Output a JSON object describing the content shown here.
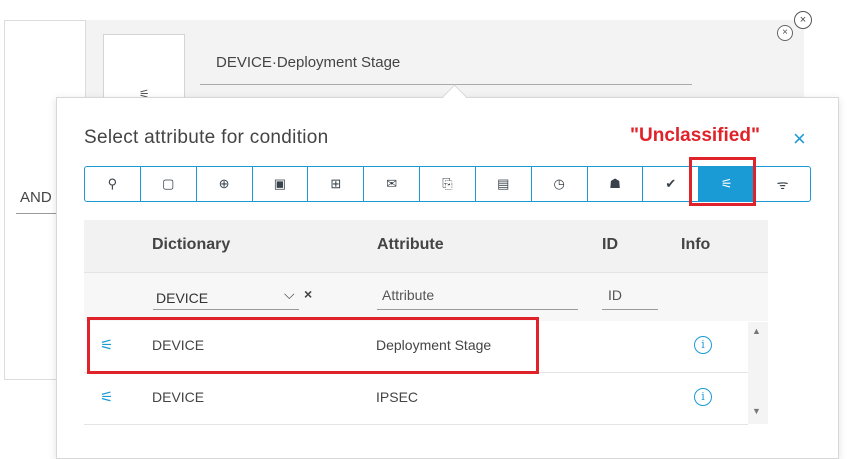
{
  "background": {
    "logic_operator": "AND",
    "condition_value": "DEVICE·Deployment Stage"
  },
  "popup": {
    "title": "Select attribute for condition",
    "annotation": "\"Unclassified\"",
    "close_glyph": "×"
  },
  "categories": [
    {
      "name": "location",
      "glyph": "⚲"
    },
    {
      "name": "endpoint",
      "glyph": "▢"
    },
    {
      "name": "network",
      "glyph": "⊕"
    },
    {
      "name": "device",
      "glyph": "▣"
    },
    {
      "name": "network-device",
      "glyph": "⊞"
    },
    {
      "name": "email",
      "glyph": "✉"
    },
    {
      "name": "certificate",
      "glyph": "⎘"
    },
    {
      "name": "server",
      "glyph": "▤"
    },
    {
      "name": "time",
      "glyph": "◷"
    },
    {
      "name": "identity",
      "glyph": "☗"
    },
    {
      "name": "posture",
      "glyph": "✔"
    },
    {
      "name": "unclassified",
      "glyph": "⚟",
      "active": true
    },
    {
      "name": "wireless",
      "glyph": "ᯤ"
    }
  ],
  "table": {
    "headers": {
      "dictionary": "Dictionary",
      "attribute": "Attribute",
      "id": "ID",
      "info": "Info"
    },
    "filters": {
      "dictionary_value": "DEVICE",
      "attribute_placeholder": "Attribute",
      "id_placeholder": "ID",
      "chevron": "⌵",
      "clear": "×"
    },
    "rows": [
      {
        "dictionary": "DEVICE",
        "attribute": "Deployment Stage",
        "id": "",
        "icon": "⚟",
        "info": "i"
      },
      {
        "dictionary": "DEVICE",
        "attribute": "IPSEC",
        "id": "",
        "icon": "⚟",
        "info": "i"
      }
    ]
  },
  "colors": {
    "accent": "#1b9bd6",
    "annotation": "#e0222a"
  }
}
